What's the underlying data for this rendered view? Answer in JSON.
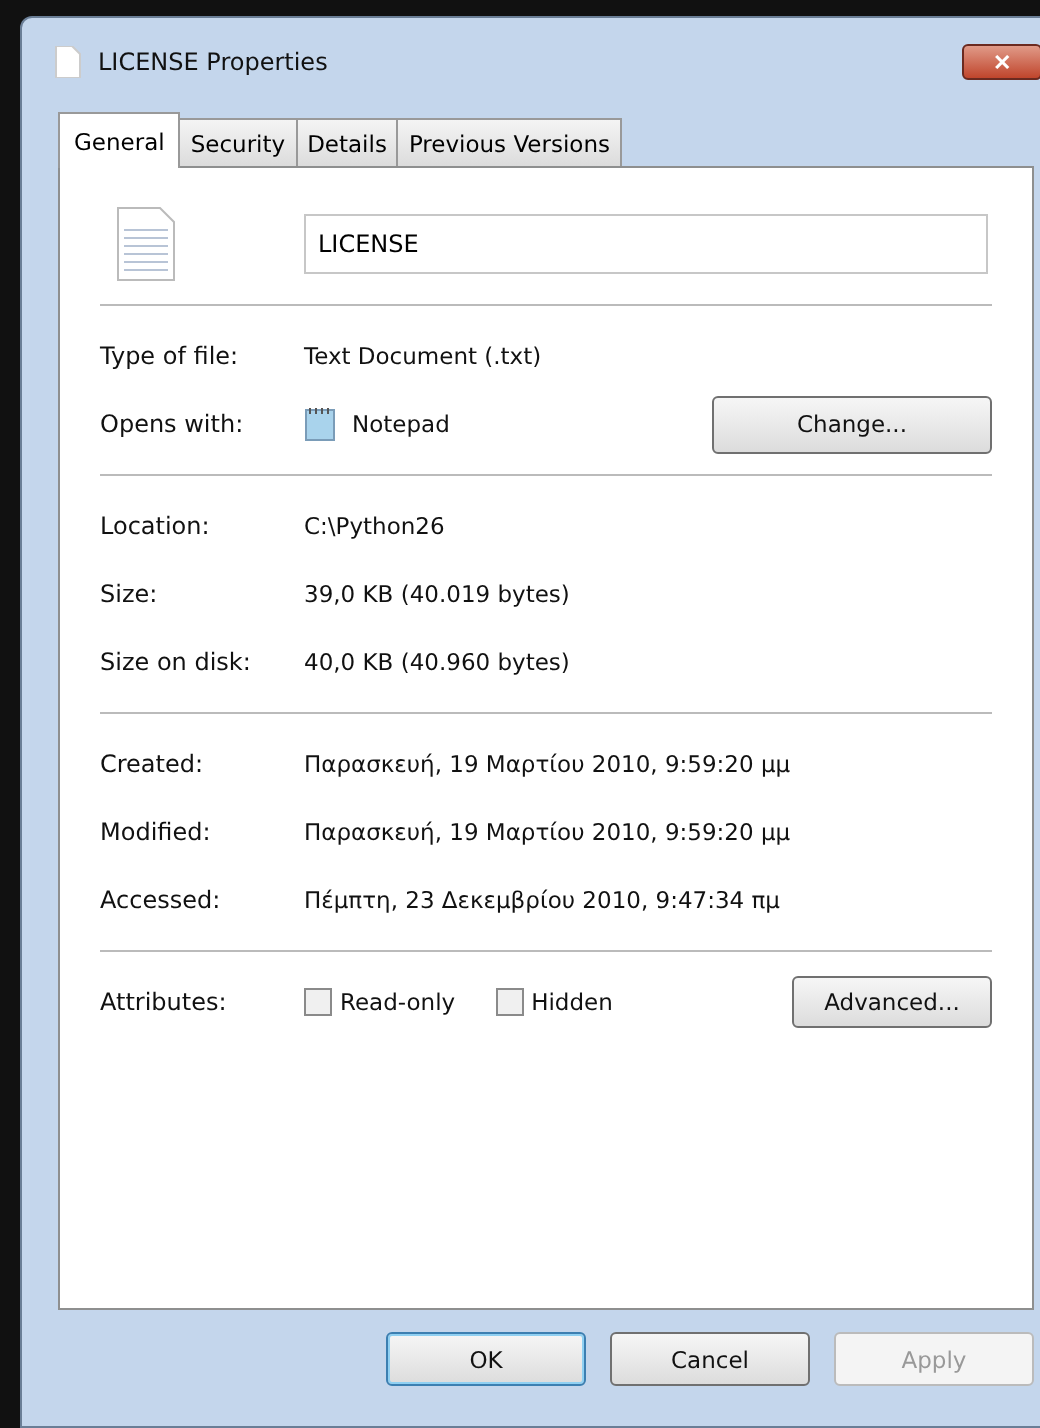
{
  "window": {
    "title": "LICENSE Properties",
    "close": "✕"
  },
  "tabs": [
    {
      "label": "General",
      "selected": true
    },
    {
      "label": "Security",
      "selected": false
    },
    {
      "label": "Details",
      "selected": false
    },
    {
      "label": "Previous Versions",
      "selected": false
    }
  ],
  "file_name": {
    "value": "LICENSE"
  },
  "type_row": {
    "label": "Type of file:",
    "value": "Text Document (.txt)"
  },
  "opens_row": {
    "label": "Opens with:",
    "value": "Notepad",
    "button": "Change..."
  },
  "location_rows": [
    {
      "label": "Location:",
      "value": "C:\\Python26"
    },
    {
      "label": "Size:",
      "value": "39,0 KB (40.019 bytes)"
    },
    {
      "label": "Size on disk:",
      "value": "40,0 KB (40.960 bytes)"
    }
  ],
  "date_rows": [
    {
      "label": "Created:",
      "value": "Παρασκευή, 19 Μαρτίου 2010, 9:59:20 μμ"
    },
    {
      "label": "Modified:",
      "value": "Παρασκευή, 19 Μαρτίου 2010, 9:59:20 μμ"
    },
    {
      "label": "Accessed:",
      "value": "Πέμπτη, 23 Δεκεμβρίου 2010, 9:47:34 πμ"
    }
  ],
  "attributes": {
    "label": "Attributes:",
    "checkboxes": [
      {
        "label": "Read-only",
        "checked": false
      },
      {
        "label": "Hidden",
        "checked": false
      }
    ],
    "button": "Advanced..."
  },
  "buttons": [
    {
      "label": "OK",
      "disabled": false,
      "default": true
    },
    {
      "label": "Cancel",
      "disabled": false,
      "default": false
    },
    {
      "label": "Apply",
      "disabled": true,
      "default": false
    }
  ]
}
